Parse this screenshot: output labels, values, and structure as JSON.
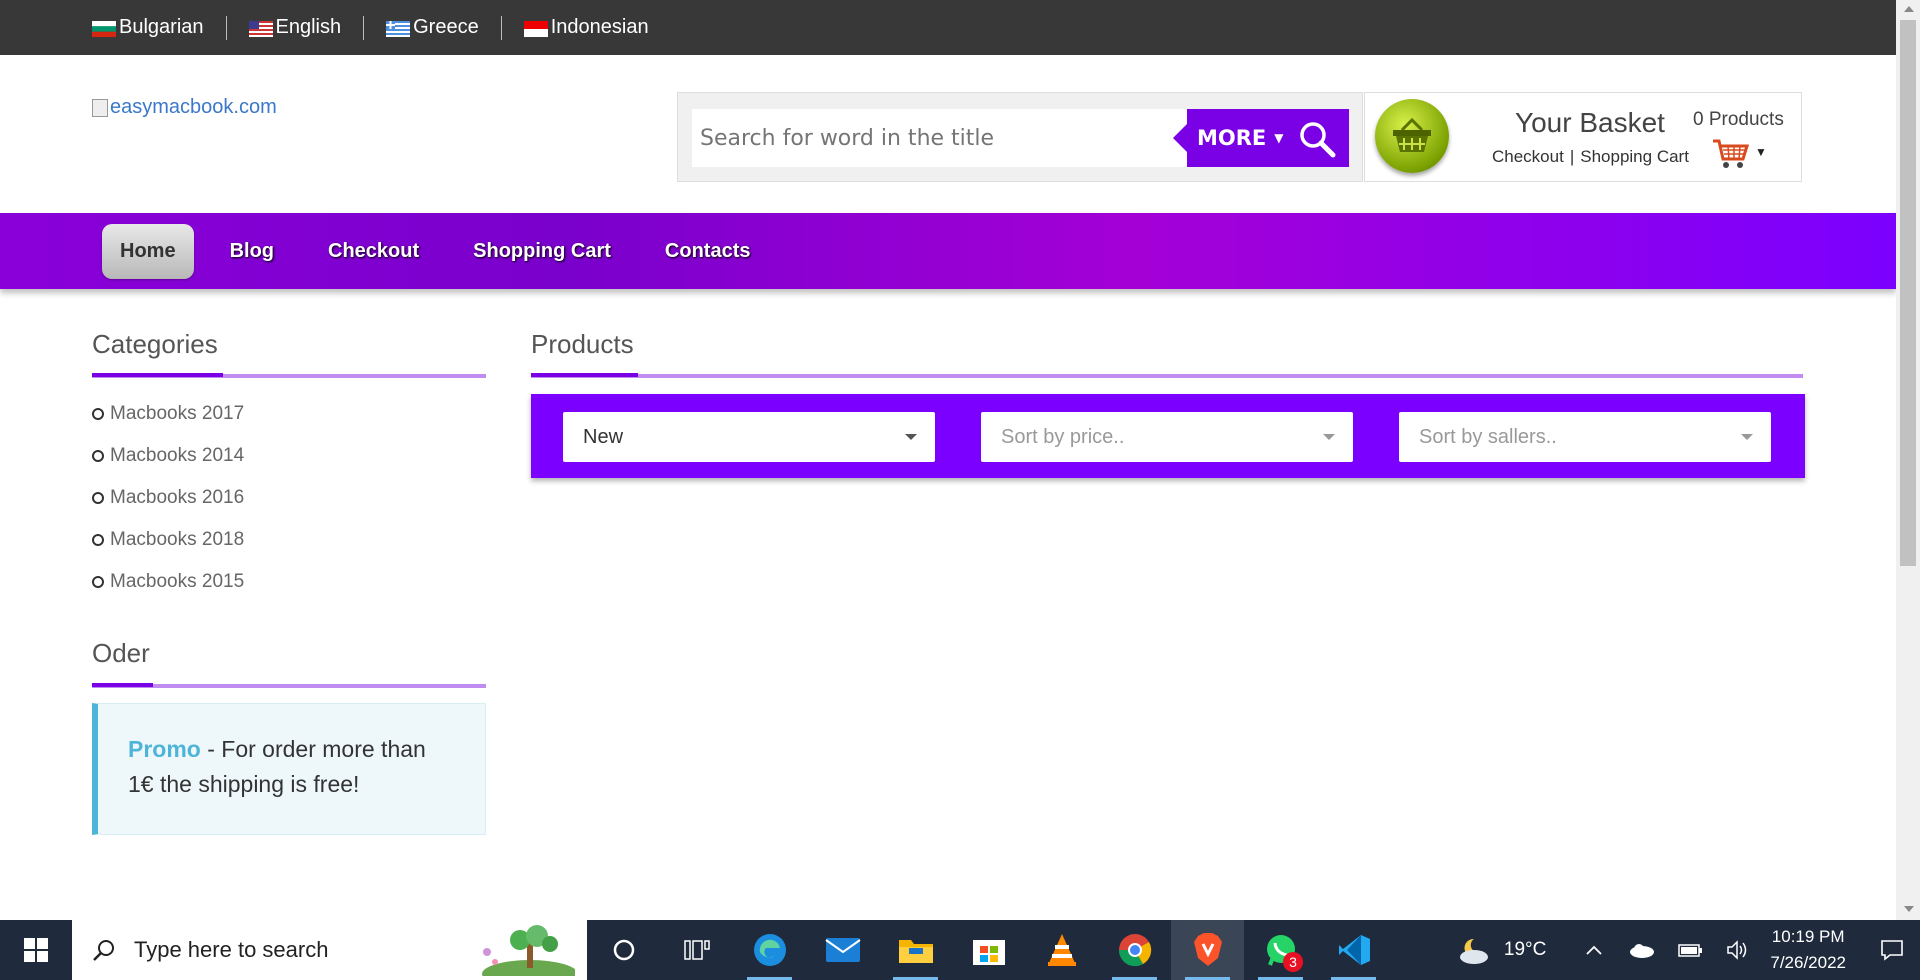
{
  "languages": [
    {
      "label": "Bulgarian",
      "flag": "bulgaria-flag-icon"
    },
    {
      "label": "English",
      "flag": "usa-flag-icon"
    },
    {
      "label": "Greece",
      "flag": "greece-flag-icon"
    },
    {
      "label": "Indonesian",
      "flag": "indonesia-flag-icon"
    }
  ],
  "logo": {
    "alt": "easymacbook.com"
  },
  "search": {
    "placeholder": "Search for word in the title",
    "more_label": "MORE"
  },
  "basket": {
    "title": "Your Basket",
    "checkout": "Checkout",
    "cart": "Shopping Cart",
    "count": "0 Products"
  },
  "nav": [
    "Home",
    "Blog",
    "Checkout",
    "Shopping Cart",
    "Contacts"
  ],
  "sidebar": {
    "categories_title": "Categories",
    "categories": [
      "Macbooks 2017",
      "Macbooks 2014",
      "Macbooks 2016",
      "Macbooks 2018",
      "Macbooks 2015"
    ],
    "order_title": "Oder",
    "promo_label": "Promo",
    "promo_text": " - For order more than 1€ the shipping is free!"
  },
  "products": {
    "title": "Products",
    "filters": [
      "New",
      "Sort by price..",
      "Sort by sallers.."
    ]
  },
  "taskbar": {
    "search_placeholder": "Type here to search",
    "whatsapp_badge": "3",
    "temperature": "19°C",
    "time": "10:19 PM",
    "date": "7/26/2022"
  },
  "colors": {
    "accent": "#7a00e6",
    "topbar": "#383838",
    "promo": "#4fb5d8"
  }
}
